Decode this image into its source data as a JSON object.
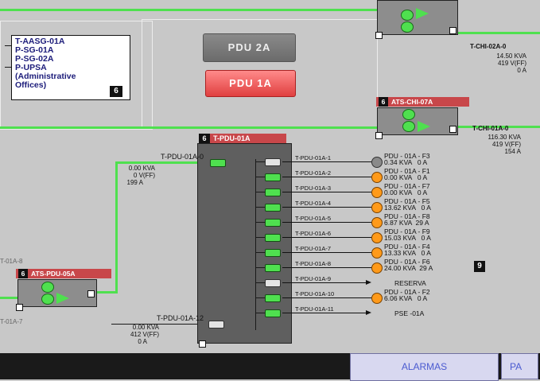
{
  "buttons": {
    "pdu2a": "PDU 2A",
    "pdu1a": "PDU 1A"
  },
  "note": {
    "lines": [
      "T-AASG-01A",
      "P-SG-01A",
      "P-SG-02A",
      "P-UPSA",
      "(Administrative",
      "Offices)"
    ],
    "badge": "6"
  },
  "right_top": {
    "label": "T-CHI-02A-0",
    "kva": "14.50 KVA",
    "v": "419 V(FF)",
    "a": "0 A"
  },
  "ats_chi": {
    "num": "6",
    "title": "ATS-CHI-07A"
  },
  "right_mid": {
    "label": "T-CHI-01A-0",
    "kva": "116.30 KVA",
    "v": "419 V(FF)",
    "a": "154 A"
  },
  "pdu_main": {
    "num": "6",
    "title": "T-PDU-01A"
  },
  "pdu_in": {
    "label": "T-PDU-01A-0",
    "kva": "0.00 KVA",
    "v": "0 V(FF)",
    "a": "199 A"
  },
  "pdu_in2": {
    "label": "T-PDU-01A-12",
    "kva": "0.00 KVA",
    "v": "412 V(FF)",
    "a": "0 A"
  },
  "ats_pdu": {
    "num": "6",
    "title": "ATS-PDU-05A"
  },
  "left_labels": {
    "a": "T-01A-8",
    "b": "T-01A-7"
  },
  "badge9": "9",
  "circuits": [
    {
      "label": "T-PDU-01A-1",
      "name": "PDU - 01A - F3",
      "val": "0.34 KVA   0 A",
      "state": "off",
      "dot": "grey"
    },
    {
      "label": "T-PDU-01A-2",
      "name": "PDU - 01A - F1",
      "val": "0.00 KVA   0 A",
      "state": "on",
      "dot": "orange"
    },
    {
      "label": "T-PDU-01A-3",
      "name": "PDU - 01A - F7",
      "val": "0.00 KVA   0 A",
      "state": "on",
      "dot": "orange"
    },
    {
      "label": "T-PDU-01A-4",
      "name": "PDU - 01A - F5",
      "val": "13.62 KVA   0 A",
      "state": "on",
      "dot": "orange"
    },
    {
      "label": "T-PDU-01A-5",
      "name": "PDU - 01A - F8",
      "val": "6.87 KVA  29 A",
      "state": "on",
      "dot": "orange"
    },
    {
      "label": "T-PDU-01A-6",
      "name": "PDU - 01A - F9",
      "val": "15.03 KVA   0 A",
      "state": "on",
      "dot": "orange"
    },
    {
      "label": "T-PDU-01A-7",
      "name": "PDU - 01A - F4",
      "val": "13.33 KVA   0 A",
      "state": "on",
      "dot": "orange"
    },
    {
      "label": "T-PDU-01A-8",
      "name": "PDU - 01A - F6",
      "val": "24.00 KVA  29 A",
      "state": "on",
      "dot": "orange"
    },
    {
      "label": "T-PDU-01A-9",
      "name": "RESERVA",
      "val": "",
      "state": "off",
      "dot": "none"
    },
    {
      "label": "T-PDU-01A-10",
      "name": "PDU - 01A - F2",
      "val": "6.06 KVA   0 A",
      "state": "on",
      "dot": "orange"
    },
    {
      "label": "T-PDU-01A-11",
      "name": "PSE -01A",
      "val": "",
      "state": "on",
      "dot": "none"
    }
  ],
  "tabs": {
    "alarmas": "ALARMAS",
    "next": "PA"
  }
}
